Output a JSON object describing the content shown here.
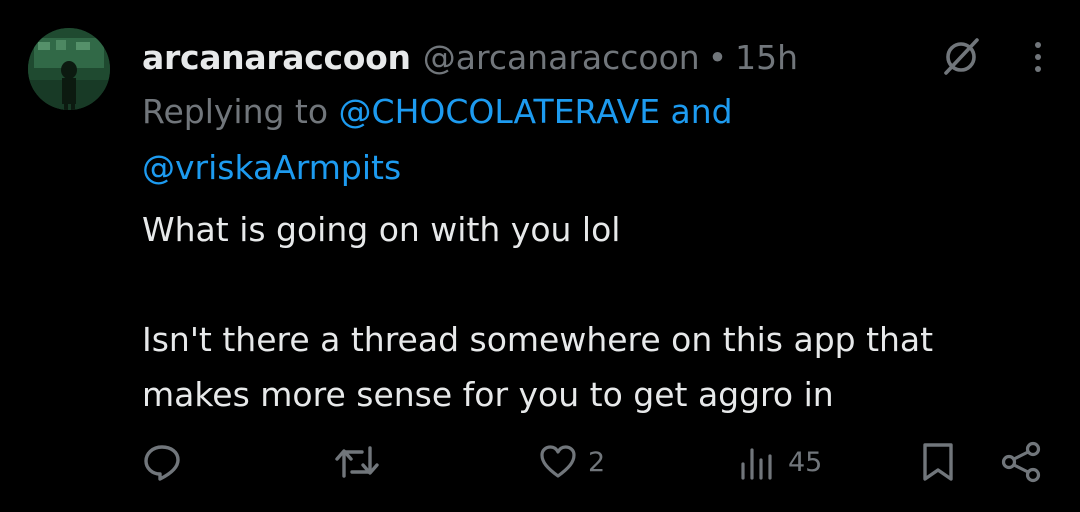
{
  "tweet": {
    "display_name": "arcanaraccoon",
    "handle": "@arcanaraccoon",
    "separator": "•",
    "time": "15h",
    "replying_prefix": "Replying to",
    "reply_mention_1": "@CHOCOLATERAVE",
    "reply_conjunction": "and",
    "reply_mention_2": "@vriskaArmpits",
    "body_line_1": "What is going on with you lol",
    "body_line_2": "Isn't there a thread somewhere on this app that makes more sense for you to get aggro in"
  },
  "actions": {
    "likes_count": "2",
    "views_count": "45"
  },
  "icons": {
    "avatar": "user-avatar",
    "grok": "grok-icon",
    "more": "more-options-icon",
    "reply": "reply-icon",
    "retweet": "retweet-icon",
    "like": "heart-icon",
    "views": "views-icon",
    "bookmark": "bookmark-icon",
    "share": "share-icon"
  },
  "colors": {
    "background": "#000000",
    "primary_text": "#e7e9ea",
    "secondary_text": "#71767b",
    "link": "#1d9bf0"
  }
}
